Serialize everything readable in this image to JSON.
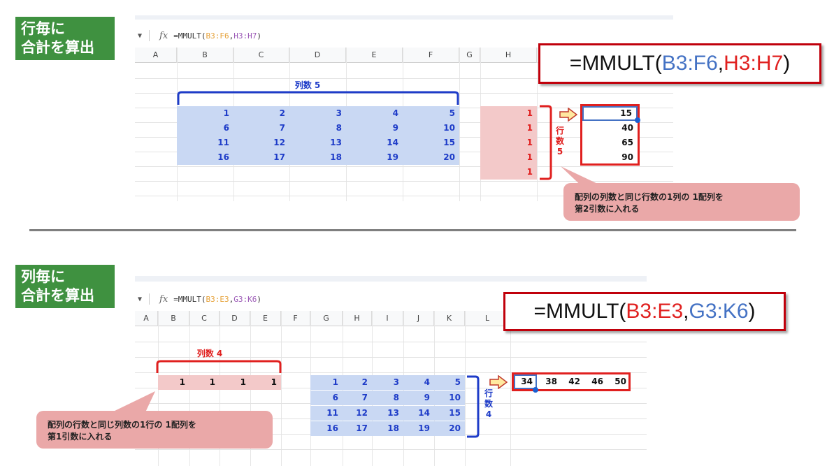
{
  "section1": {
    "tag_line1": "行毎に",
    "tag_line2": "合計を算出",
    "formula_bar": {
      "prefix": "=MMULT(",
      "arg1": "B3:F6",
      "comma": ",",
      "arg2": "H3:H7",
      "suffix": ")"
    },
    "columns": [
      "A",
      "B",
      "C",
      "D",
      "E",
      "F",
      "G",
      "H"
    ],
    "matrix": [
      [
        1,
        2,
        3,
        4,
        5
      ],
      [
        6,
        7,
        8,
        9,
        10
      ],
      [
        11,
        12,
        13,
        14,
        15
      ],
      [
        16,
        17,
        18,
        19,
        20
      ]
    ],
    "vector": [
      1,
      1,
      1,
      1,
      1
    ],
    "result": [
      15,
      40,
      65,
      90
    ],
    "big_formula": {
      "prefix": "=MMULT(",
      "arg1": "B3:F6",
      "comma": ",",
      "arg2": "H3:H7",
      "suffix": ")"
    },
    "col_count_label": "列数 5",
    "row_count_line1": "行",
    "row_count_line2": "数",
    "row_count_line3": "5",
    "note_line1": "配列の列数と同じ行数の1列の 1配列を",
    "note_line2": "第2引数に入れる"
  },
  "section2": {
    "tag_line1": "列毎に",
    "tag_line2": "合計を算出",
    "formula_bar": {
      "prefix": "=MMULT(",
      "arg1": "B3:E3",
      "comma": ",",
      "arg2": "G3:K6",
      "suffix": ")"
    },
    "columns": [
      "A",
      "B",
      "C",
      "D",
      "E",
      "F",
      "G",
      "H",
      "I",
      "J",
      "K",
      "L"
    ],
    "vector": [
      1,
      1,
      1,
      1
    ],
    "matrix": [
      [
        1,
        2,
        3,
        4,
        5
      ],
      [
        6,
        7,
        8,
        9,
        10
      ],
      [
        11,
        12,
        13,
        14,
        15
      ],
      [
        16,
        17,
        18,
        19,
        20
      ]
    ],
    "result": [
      34,
      38,
      42,
      46,
      50
    ],
    "big_formula": {
      "prefix": "=MMULT(",
      "arg1": "B3:E3",
      "comma": ",",
      "arg2": "G3:K6",
      "suffix": ")"
    },
    "col_count_label": "列数 4",
    "row_count_line1": "行",
    "row_count_line2": "数",
    "row_count_line3": "4",
    "note_line1": "配列の行数と同じ列数の1行の 1配列を",
    "note_line2": "第1引数に入れる"
  },
  "colors": {
    "tag_green": "#3f9140",
    "blue_fill": "#c9d8f3",
    "pink_fill": "#f3c9c9",
    "red": "#e0201f",
    "blue_text": "#1e3cc8"
  }
}
